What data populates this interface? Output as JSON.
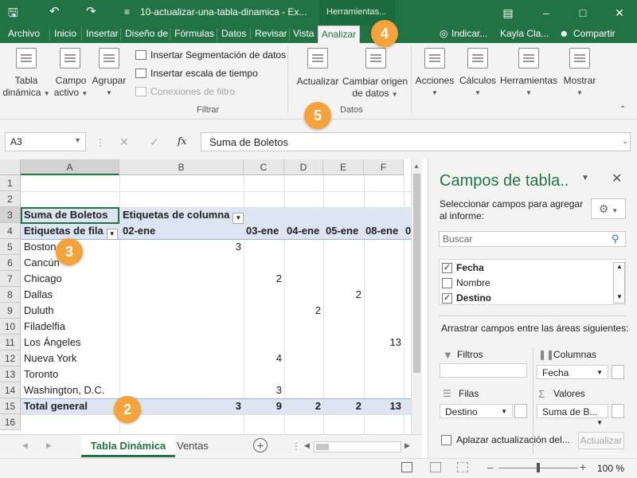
{
  "titlebar": {
    "filename": "10-actualizar-una-tabla-dinamica - Ex...",
    "context_tools": "Herramientas...",
    "quick_menu_marker": "≡"
  },
  "menu": {
    "items": [
      "Archivo",
      "Inicio",
      "Insertar",
      "Diseño de",
      "Fórmulas",
      "Datos",
      "Revisar",
      "Vista",
      "Analizar"
    ],
    "tell_me": "Indicar...",
    "user": "Kayla Cla...",
    "share": "Compartir"
  },
  "ribbon": {
    "pivot_table": [
      "Tabla",
      "dinámica"
    ],
    "active_field": [
      "Campo",
      "activo"
    ],
    "group": "Agrupar",
    "insert_slicer": "Insertar Segmentación de datos",
    "insert_timeline": "Insertar escala de tiempo",
    "filter_connections": "Conexiones de filtro",
    "filter_group": "Filtrar",
    "refresh": "Actualizar",
    "change_source": [
      "Cambiar origen",
      "de datos"
    ],
    "data_group": "Datos",
    "actions": "Acciones",
    "calculations": "Cálculos",
    "tools": "Herramientas",
    "show": "Mostrar"
  },
  "callouts": [
    "4",
    "5",
    "3",
    "2"
  ],
  "formula_bar": {
    "name_box": "A3",
    "fx": "fx",
    "content": "Suma de Boletos"
  },
  "grid": {
    "columns": [
      "A",
      "B",
      "C",
      "D",
      "E",
      "F"
    ],
    "rows": [
      "1",
      "2",
      "3",
      "4",
      "5",
      "6",
      "7",
      "8",
      "9",
      "10",
      "11",
      "12",
      "13",
      "14",
      "15",
      "16"
    ],
    "r3a": "Suma de Boletos",
    "r3b": "Etiquetas de columna",
    "r4a": "Etiquetas de fila",
    "dates": [
      "02-ene",
      "03-ene",
      "04-ene",
      "05-ene",
      "08-ene",
      "0"
    ],
    "cities": [
      "Boston",
      "Cancún",
      "Chicago",
      "Dallas",
      "Duluth",
      "Filadelfia",
      "Los Ángeles",
      "Nueva York",
      "Toronto",
      "Washington, D.C."
    ],
    "values": {
      "boston_b": "3",
      "chicago_c": "2",
      "dallas_e": "2",
      "duluth_d": "2",
      "losangeles_f": "13",
      "nuevayork_c": "4",
      "washington_c": "3"
    },
    "total_label": "Total general",
    "totals": [
      "3",
      "9",
      "2",
      "2",
      "13"
    ]
  },
  "sheets": {
    "active": "Tabla Dinámica",
    "other": "Ventas"
  },
  "status": {
    "zoom": "100 %"
  },
  "pane": {
    "title": "Campos de tabla..",
    "prompt": [
      "Seleccionar campos para agregar",
      "al informe:"
    ],
    "search_placeholder": "Buscar",
    "fields": [
      {
        "label": "Fecha",
        "checked": true
      },
      {
        "label": "Nombre",
        "checked": false
      },
      {
        "label": "Destino",
        "checked": true
      }
    ],
    "drag_hint": "Arrastrar campos entre las áreas siguientes:",
    "filters": "Filtros",
    "columns": "Columnas",
    "columns_value": "Fecha",
    "rows": "Filas",
    "rows_value": "Destino",
    "values": "Valores",
    "values_value": "Suma de B...",
    "defer": "Aplazar actualización del...",
    "update": "Actualizar"
  },
  "colors": {
    "excel_green": "#217346",
    "callout": "#f4a33a",
    "pivot_band": "#dde5f3"
  }
}
